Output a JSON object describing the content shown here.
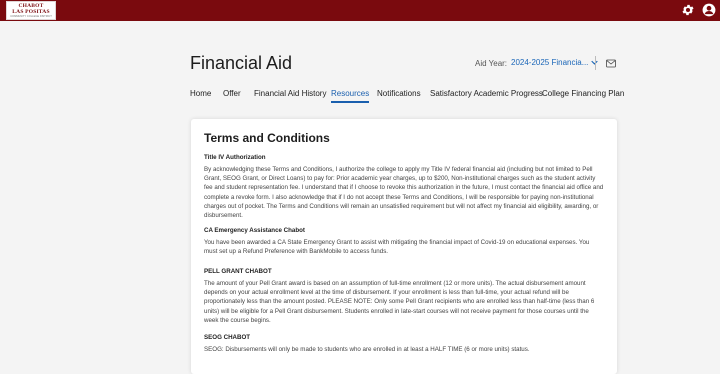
{
  "header": {
    "logo": {
      "line1": "CHABOT",
      "line2": "LAS POSITAS",
      "line3": "COMMUNITY COLLEGE DISTRICT"
    },
    "icons": [
      "gear-icon",
      "user-icon"
    ],
    "colors": {
      "brand": "#7a0a0e",
      "accent": "#1a5fae"
    }
  },
  "page": {
    "title": "Financial Aid",
    "aid_year_label": "Aid Year:",
    "aid_year_value": "2024-2025 Financia..."
  },
  "tabs": [
    {
      "label": "Home"
    },
    {
      "label": "Offer"
    },
    {
      "label": "Financial Aid History"
    },
    {
      "label": "Resources",
      "active": true
    },
    {
      "label": "Notifications"
    },
    {
      "label": "Satisfactory Academic Progress"
    },
    {
      "label": "College Financing Plan"
    }
  ],
  "terms": {
    "title": "Terms and Conditions",
    "sections": [
      {
        "heading": "Title IV Authorization",
        "body": "By acknowledging these Terms and Conditions, I authorize the college to apply my Title IV federal financial aid (including but not limited to Pell Grant, SEOG Grant, or Direct Loans) to pay for: Prior academic year charges, up to $200, Non-institutional charges such as the student activity fee and student representation fee. I understand that if I choose to revoke this authorization in the future, I must contact the financial aid office and complete a revoke form. I also acknowledge that if I do not accept these Terms and Conditions, I will be responsible for paying non-institutional charges out of pocket. The Terms and Conditions will remain an unsatisfied requirement but will not affect my financial aid eligibility, awarding, or disbursement."
      },
      {
        "heading": "CA Emergency Assistance Chabot",
        "body": "You have been awarded a CA State Emergency Grant to assist with mitigating the financial impact of Covid-19 on educational expenses. You must set up a Refund Preference with BankMobile to access funds."
      },
      {
        "heading": "PELL GRANT CHABOT",
        "body": "The amount of your Pell Grant award is based on an assumption of full-time enrollment (12 or more units). The actual disbursement amount depends on your actual enrollment level at the time of disbursement. If your enrollment is less than full-time, your actual refund will be proportionately less than the amount posted. PLEASE NOTE: Only some Pell Grant recipients who are enrolled less than half-time (less than 6 units) will be eligible for a Pell Grant disbursement. Students enrolled in late-start courses will not receive payment for those courses until the week the course begins."
      },
      {
        "heading": "SEOG CHABOT",
        "body": "SEOG: Disbursements will only be made to students who are enrolled in at least a HALF TIME (6 or more units) status."
      }
    ]
  }
}
